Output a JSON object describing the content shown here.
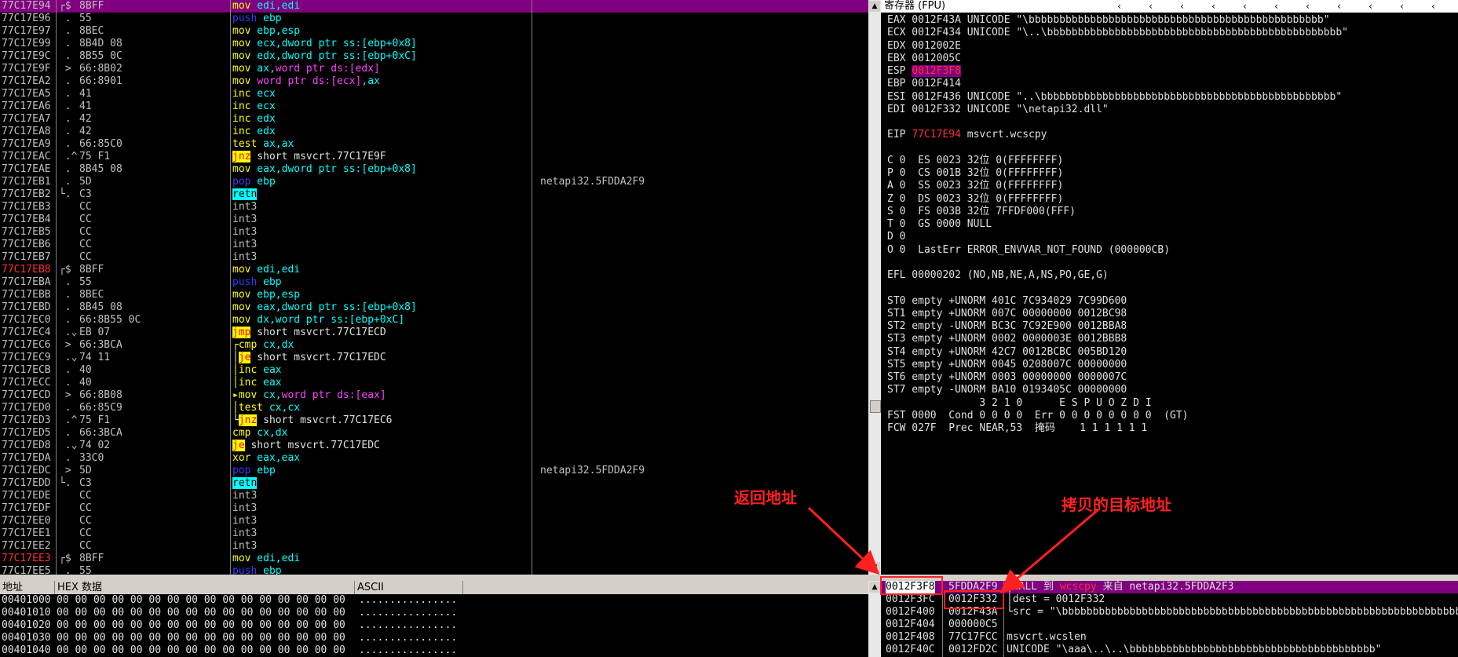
{
  "disasm": {
    "rows": [
      {
        "addr": "77C17E94",
        "hex": "8BFF",
        "ins": [
          [
            "mov",
            "k-mov"
          ],
          [
            " edi,edi",
            "k-reg"
          ]
        ],
        "com": "",
        "sel": true,
        "bracket": "┌$"
      },
      {
        "addr": "77C17E96",
        "hex": "55",
        "ins": [
          [
            "push",
            "k-push"
          ],
          [
            " ebp",
            "k-reg"
          ]
        ],
        "com": "",
        "bracket": " ."
      },
      {
        "addr": "77C17E97",
        "hex": "8BEC",
        "ins": [
          [
            "mov",
            "k-mov"
          ],
          [
            " ebp,esp",
            "k-reg"
          ]
        ],
        "com": "",
        "bracket": " ."
      },
      {
        "addr": "77C17E99",
        "hex": "8B4D 08",
        "ins": [
          [
            "mov",
            "k-mov"
          ],
          [
            " ecx,",
            "k-reg"
          ],
          [
            "dword ptr ss:[ebp+0x8]",
            "k-reg"
          ]
        ],
        "com": "",
        "bracket": " ."
      },
      {
        "addr": "77C17E9C",
        "hex": "8B55 0C",
        "ins": [
          [
            "mov",
            "k-mov"
          ],
          [
            " edx,",
            "k-reg"
          ],
          [
            "dword ptr ss:[ebp+0xC]",
            "k-reg"
          ]
        ],
        "com": "",
        "bracket": " ."
      },
      {
        "addr": "77C17E9F",
        "hex": "66:8B02",
        "ins": [
          [
            "mov",
            "k-mov"
          ],
          [
            " ax,",
            "k-reg"
          ],
          [
            "word ptr ds:[edx]",
            "k-mem"
          ]
        ],
        "com": "",
        "bracket": " >"
      },
      {
        "addr": "77C17EA2",
        "hex": "66:8901",
        "ins": [
          [
            "mov",
            "k-mov"
          ],
          [
            " ",
            "k-plain"
          ],
          [
            "word ptr ds:[ecx]",
            "k-mem"
          ],
          [
            ",ax",
            "k-reg"
          ]
        ],
        "com": "",
        "bracket": " ."
      },
      {
        "addr": "77C17EA5",
        "hex": "41",
        "ins": [
          [
            "inc",
            "k-inc"
          ],
          [
            " ecx",
            "k-reg"
          ]
        ],
        "com": "",
        "bracket": " ."
      },
      {
        "addr": "77C17EA6",
        "hex": "41",
        "ins": [
          [
            "inc",
            "k-inc"
          ],
          [
            " ecx",
            "k-reg"
          ]
        ],
        "com": "",
        "bracket": " ."
      },
      {
        "addr": "77C17EA7",
        "hex": "42",
        "ins": [
          [
            "inc",
            "k-inc"
          ],
          [
            " edx",
            "k-reg"
          ]
        ],
        "com": "",
        "bracket": " ."
      },
      {
        "addr": "77C17EA8",
        "hex": "42",
        "ins": [
          [
            "inc",
            "k-inc"
          ],
          [
            " edx",
            "k-reg"
          ]
        ],
        "com": "",
        "bracket": " ."
      },
      {
        "addr": "77C17EA9",
        "hex": "66:85C0",
        "ins": [
          [
            "test",
            "k-test"
          ],
          [
            " ax,ax",
            "k-reg"
          ]
        ],
        "com": "",
        "bracket": " ."
      },
      {
        "addr": "77C17EAC",
        "hex": "75 F1",
        "ins": [
          [
            "jnz",
            "k-jcc"
          ],
          [
            " short msvcrt.77C17E9F",
            "k-plain"
          ]
        ],
        "com": "",
        "bracket": " .^"
      },
      {
        "addr": "77C17EAE",
        "hex": "8B45 08",
        "ins": [
          [
            "mov",
            "k-mov"
          ],
          [
            " eax,",
            "k-reg"
          ],
          [
            "dword ptr ss:[ebp+0x8]",
            "k-reg"
          ]
        ],
        "com": "",
        "bracket": " ."
      },
      {
        "addr": "77C17EB1",
        "hex": "5D",
        "ins": [
          [
            "pop",
            "k-pop"
          ],
          [
            " ebp",
            "k-reg"
          ]
        ],
        "com": "netapi32.5FDDA2F9",
        "bracket": " ."
      },
      {
        "addr": "77C17EB2",
        "hex": "C3",
        "ins": [
          [
            "retn",
            "k-ret"
          ]
        ],
        "com": "",
        "bracket": "└."
      },
      {
        "addr": "77C17EB3",
        "hex": "CC",
        "ins": [
          [
            "int3",
            "k-int"
          ]
        ],
        "com": "",
        "bracket": ""
      },
      {
        "addr": "77C17EB4",
        "hex": "CC",
        "ins": [
          [
            "int3",
            "k-int"
          ]
        ],
        "com": "",
        "bracket": ""
      },
      {
        "addr": "77C17EB5",
        "hex": "CC",
        "ins": [
          [
            "int3",
            "k-int"
          ]
        ],
        "com": "",
        "bracket": ""
      },
      {
        "addr": "77C17EB6",
        "hex": "CC",
        "ins": [
          [
            "int3",
            "k-int"
          ]
        ],
        "com": "",
        "bracket": ""
      },
      {
        "addr": "77C17EB7",
        "hex": "CC",
        "ins": [
          [
            "int3",
            "k-int"
          ]
        ],
        "com": "",
        "bracket": ""
      },
      {
        "addr": "77C17EB8",
        "hex": "8BFF",
        "ins": [
          [
            "mov",
            "k-mov"
          ],
          [
            " edi,edi",
            "k-reg"
          ]
        ],
        "com": "",
        "bracket": "┌$",
        "red": true
      },
      {
        "addr": "77C17EBA",
        "hex": "55",
        "ins": [
          [
            "push",
            "k-push"
          ],
          [
            " ebp",
            "k-reg"
          ]
        ],
        "com": "",
        "bracket": " ."
      },
      {
        "addr": "77C17EBB",
        "hex": "8BEC",
        "ins": [
          [
            "mov",
            "k-mov"
          ],
          [
            " ebp,esp",
            "k-reg"
          ]
        ],
        "com": "",
        "bracket": " ."
      },
      {
        "addr": "77C17EBD",
        "hex": "8B45 08",
        "ins": [
          [
            "mov",
            "k-mov"
          ],
          [
            " eax,",
            "k-reg"
          ],
          [
            "dword ptr ss:[ebp+0x8]",
            "k-reg"
          ]
        ],
        "com": "",
        "bracket": " ."
      },
      {
        "addr": "77C17EC0",
        "hex": "66:8B55 0C",
        "ins": [
          [
            "mov",
            "k-mov"
          ],
          [
            " dx,",
            "k-reg"
          ],
          [
            "word ptr ss:[ebp+0xC]",
            "k-reg"
          ]
        ],
        "com": "",
        "bracket": " ."
      },
      {
        "addr": "77C17EC4",
        "hex": "EB 07",
        "ins": [
          [
            "jmp",
            "k-jcc"
          ],
          [
            " short msvcrt.77C17ECD",
            "k-plain"
          ]
        ],
        "com": "",
        "bracket": " .⌄"
      },
      {
        "addr": "77C17EC6",
        "hex": "66:3BCA",
        "ins": [
          [
            "┌cmp",
            "k-cmp"
          ],
          [
            " cx,dx",
            "k-reg"
          ]
        ],
        "com": "",
        "bracket": " >"
      },
      {
        "addr": "77C17EC9",
        "hex": "74 11",
        "ins": [
          [
            "│",
            "k-plain"
          ],
          [
            "je",
            "k-jcc"
          ],
          [
            " short msvcrt.77C17EDC",
            "k-plain"
          ]
        ],
        "com": "",
        "bracket": " .⌄"
      },
      {
        "addr": "77C17ECB",
        "hex": "40",
        "ins": [
          [
            "│inc",
            "k-inc"
          ],
          [
            " eax",
            "k-reg"
          ]
        ],
        "com": "",
        "bracket": " ."
      },
      {
        "addr": "77C17ECC",
        "hex": "40",
        "ins": [
          [
            "│inc",
            "k-inc"
          ],
          [
            " eax",
            "k-reg"
          ]
        ],
        "com": "",
        "bracket": " ."
      },
      {
        "addr": "77C17ECD",
        "hex": "66:8B08",
        "ins": [
          [
            "▸mov",
            "k-mov"
          ],
          [
            " cx,",
            "k-reg"
          ],
          [
            "word ptr ds:[eax]",
            "k-mem"
          ]
        ],
        "com": "",
        "bracket": " >"
      },
      {
        "addr": "77C17ED0",
        "hex": "66:85C9",
        "ins": [
          [
            "│test",
            "k-test"
          ],
          [
            " cx,cx",
            "k-reg"
          ]
        ],
        "com": "",
        "bracket": " ."
      },
      {
        "addr": "77C17ED3",
        "hex": "75 F1",
        "ins": [
          [
            "└",
            "k-plain"
          ],
          [
            "jnz",
            "k-jcc"
          ],
          [
            " short msvcrt.77C17EC6",
            "k-plain"
          ]
        ],
        "com": "",
        "bracket": " .^"
      },
      {
        "addr": "77C17ED5",
        "hex": "66:3BCA",
        "ins": [
          [
            "cmp",
            "k-cmp"
          ],
          [
            " cx,dx",
            "k-reg"
          ]
        ],
        "com": "",
        "bracket": " ."
      },
      {
        "addr": "77C17ED8",
        "hex": "74 02",
        "ins": [
          [
            "je",
            "k-jcc"
          ],
          [
            " short msvcrt.77C17EDC",
            "k-plain"
          ]
        ],
        "com": "",
        "bracket": " .⌄"
      },
      {
        "addr": "77C17EDA",
        "hex": "33C0",
        "ins": [
          [
            "xor",
            "k-xor"
          ],
          [
            " eax,eax",
            "k-reg"
          ]
        ],
        "com": "",
        "bracket": " ."
      },
      {
        "addr": "77C17EDC",
        "hex": "5D",
        "ins": [
          [
            "pop",
            "k-pop"
          ],
          [
            " ebp",
            "k-reg"
          ]
        ],
        "com": "netapi32.5FDDA2F9",
        "bracket": " >"
      },
      {
        "addr": "77C17EDD",
        "hex": "C3",
        "ins": [
          [
            "retn",
            "k-ret"
          ]
        ],
        "com": "",
        "bracket": "└."
      },
      {
        "addr": "77C17EDE",
        "hex": "CC",
        "ins": [
          [
            "int3",
            "k-int"
          ]
        ],
        "com": "",
        "bracket": ""
      },
      {
        "addr": "77C17EDF",
        "hex": "CC",
        "ins": [
          [
            "int3",
            "k-int"
          ]
        ],
        "com": "",
        "bracket": ""
      },
      {
        "addr": "77C17EE0",
        "hex": "CC",
        "ins": [
          [
            "int3",
            "k-int"
          ]
        ],
        "com": "",
        "bracket": ""
      },
      {
        "addr": "77C17EE1",
        "hex": "CC",
        "ins": [
          [
            "int3",
            "k-int"
          ]
        ],
        "com": "",
        "bracket": ""
      },
      {
        "addr": "77C17EE2",
        "hex": "CC",
        "ins": [
          [
            "int3",
            "k-int"
          ]
        ],
        "com": "",
        "bracket": ""
      },
      {
        "addr": "77C17EE3",
        "hex": "8BFF",
        "ins": [
          [
            "mov",
            "k-mov"
          ],
          [
            " edi,edi",
            "k-reg"
          ]
        ],
        "com": "",
        "bracket": "┌$",
        "red": true
      },
      {
        "addr": "77C17EE5",
        "hex": "55",
        "ins": [
          [
            "push",
            "k-push"
          ],
          [
            " ebp",
            "k-reg"
          ]
        ],
        "com": "",
        "bracket": " ."
      }
    ]
  },
  "regs": {
    "title": "寄存器 (FPU)",
    "lines": [
      "EAX 0012F43A UNICODE \"\\bbbbbbbbbbbbbbbbbbbbbbbbbbbbbbbbbbbbbbbbbbbbbbbb\"",
      "ECX 0012F434 UNICODE \"\\..\\bbbbbbbbbbbbbbbbbbbbbbbbbbbbbbbbbbbbbbbbbbbbbbbb\"",
      "EDX 0012002E",
      "EBX 0012005C",
      "ESP|0012F3F8",
      "EBP 0012F414",
      "ESI 0012F436 UNICODE \"..\\bbbbbbbbbbbbbbbbbbbbbbbbbbbbbbbbbbbbbbbbbbbbbbbb\"",
      "EDI 0012F332 UNICODE \"\\netapi32.dll\"",
      "",
      "EIP|77C17E94|msvcrt.wcscpy",
      "",
      "C 0  ES 0023 32位 0(FFFFFFFF)",
      "P 0  CS 001B 32位 0(FFFFFFFF)",
      "A 0  SS 0023 32位 0(FFFFFFFF)",
      "Z 0  DS 0023 32位 0(FFFFFFFF)",
      "S 0  FS 003B 32位 7FFDF000(FFF)",
      "T 0  GS 0000 NULL",
      "D 0",
      "O 0  LastErr ERROR_ENVVAR_NOT_FOUND (000000CB)",
      "",
      "EFL 00000202 (NO,NB,NE,A,NS,PO,GE,G)",
      "",
      "ST0 empty +UNORM 401C 7C934029 7C99D600",
      "ST1 empty +UNORM 007C 00000000 0012BC98",
      "ST2 empty -UNORM BC3C 7C92E900 0012BBA8",
      "ST3 empty +UNORM 0002 0000003E 0012BBB8",
      "ST4 empty +UNORM 42C7 0012BCBC 005BD120",
      "ST5 empty +UNORM 0045 0208007C 00000000",
      "ST6 empty +UNORM 0003 00000000 0000007C",
      "ST7 empty -UNORM BA10 0193405C 00000000",
      "               3 2 1 0      E S P U O Z D I",
      "FST 0000  Cond 0 0 0 0  Err 0 0 0 0 0 0 0 0  (GT)",
      "FCW 027F  Prec NEAR,53  掩码    1 1 1 1 1 1"
    ]
  },
  "dump": {
    "headers": {
      "addr": "地址",
      "hex": "HEX 数据",
      "ascii": "ASCII"
    },
    "rows": [
      "00401000|00 00 00 00 00 00 00 00 00 00 00 00 00 00 00 00|................",
      "00401010|00 00 00 00 00 00 00 00 00 00 00 00 00 00 00 00|................",
      "00401020|00 00 00 00 00 00 00 00 00 00 00 00 00 00 00 00|................",
      "00401030|00 00 00 00 00 00 00 00 00 00 00 00 00 00 00 00|................",
      "00401040|00 00 00 00 00 00 00 00 00 00 00 00 00 00 00 00|................"
    ]
  },
  "stack": {
    "rows": [
      {
        "addr": "0012F3F8",
        "val": "5FDDA2F9",
        "com": "┌CALL 到 wcscpy 来自 netapi32.5FDDA2F3",
        "sel": true
      },
      {
        "addr": "0012F3FC",
        "val": "0012F332",
        "com": "│dest = 0012F332"
      },
      {
        "addr": "0012F400",
        "val": "0012F43A",
        "com": "└src = \"\\bbbbbbbbbbbbbbbbbbbbbbbbbbbbbbbbbbbbbbbbbbbbbbbbbbbbbbbbbbbbbbbbbbbbbbbbbbbb"
      },
      {
        "addr": "0012F404",
        "val": "000000C5",
        "com": ""
      },
      {
        "addr": "0012F408",
        "val": "77C17FCC",
        "com": "msvcrt.wcslen"
      },
      {
        "addr": "0012F40C",
        "val": "0012FD2C",
        "com": "UNICODE \"\\aaa\\..\\..\\bbbbbbbbbbbbbbbbbbbbbbbbbbbbbbbbbbbbbbbb\""
      }
    ]
  },
  "annotations": {
    "return_address": "返回地址",
    "copy_target": "拷贝的目标地址"
  }
}
